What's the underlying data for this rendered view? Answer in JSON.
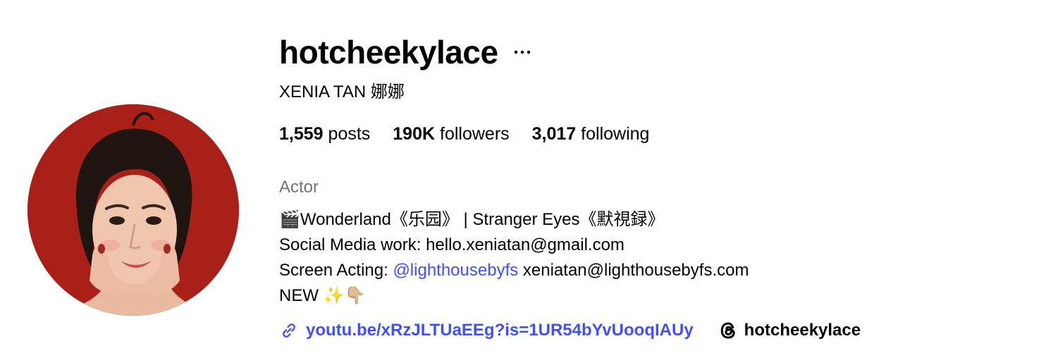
{
  "profile": {
    "username": "hotcheekylace",
    "full_name": "XENIA TAN 娜娜",
    "more_icon": "more-horizontal-icon",
    "stats": {
      "posts_count": "1,559",
      "posts_label": "posts",
      "followers_count": "190K",
      "followers_label": "followers",
      "following_count": "3,017",
      "following_label": "following"
    },
    "category": "Actor",
    "bio": {
      "line1": "🎬Wonderland《乐园》 | Stranger Eyes《默視録》",
      "line2": "Social Media work: hello.xeniatan@gmail.com",
      "line3_prefix": "Screen Acting: ",
      "line3_mention": "@lighthousebyfs",
      "line3_suffix": " xeniatan@lighthousebyfs.com",
      "line4": "NEW ✨👇🏼"
    },
    "external_link": {
      "icon": "link-icon",
      "text": "youtu.be/xRzJLTUaEEg?is=1UR54bYvUooqIAUy"
    },
    "threads_link": {
      "icon": "threads-icon",
      "text": "hotcheekylace"
    },
    "colors": {
      "link": "#4150f7",
      "secondary_text": "#737373",
      "avatar_background": "#b2231b"
    }
  }
}
